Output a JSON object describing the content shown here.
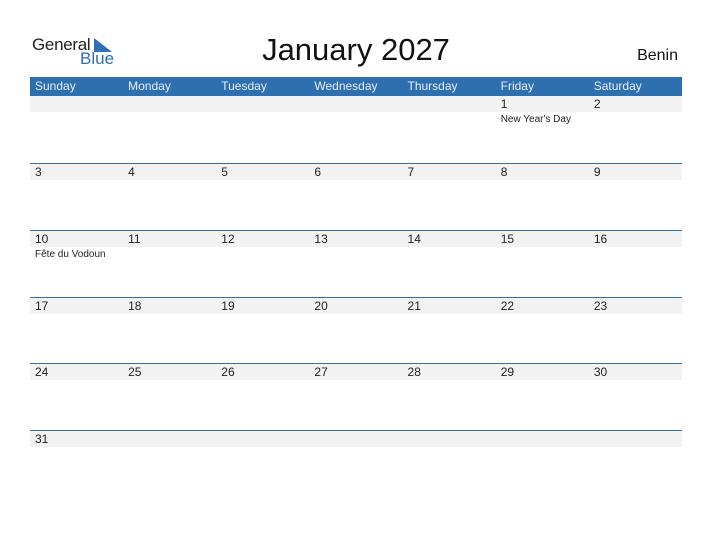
{
  "logo": {
    "part1": "General",
    "part2": "Blue"
  },
  "title": "January 2027",
  "country": "Benin",
  "days": [
    "Sunday",
    "Monday",
    "Tuesday",
    "Wednesday",
    "Thursday",
    "Friday",
    "Saturday"
  ],
  "weeks": [
    [
      {
        "d": ""
      },
      {
        "d": ""
      },
      {
        "d": ""
      },
      {
        "d": ""
      },
      {
        "d": ""
      },
      {
        "d": "1",
        "h": "New Year's Day"
      },
      {
        "d": "2"
      }
    ],
    [
      {
        "d": "3"
      },
      {
        "d": "4"
      },
      {
        "d": "5"
      },
      {
        "d": "6"
      },
      {
        "d": "7"
      },
      {
        "d": "8"
      },
      {
        "d": "9"
      }
    ],
    [
      {
        "d": "10",
        "h": "Fête du Vodoun"
      },
      {
        "d": "11"
      },
      {
        "d": "12"
      },
      {
        "d": "13"
      },
      {
        "d": "14"
      },
      {
        "d": "15"
      },
      {
        "d": "16"
      }
    ],
    [
      {
        "d": "17"
      },
      {
        "d": "18"
      },
      {
        "d": "19"
      },
      {
        "d": "20"
      },
      {
        "d": "21"
      },
      {
        "d": "22"
      },
      {
        "d": "23"
      }
    ],
    [
      {
        "d": "24"
      },
      {
        "d": "25"
      },
      {
        "d": "26"
      },
      {
        "d": "27"
      },
      {
        "d": "28"
      },
      {
        "d": "29"
      },
      {
        "d": "30"
      }
    ],
    [
      {
        "d": "31"
      },
      {
        "d": ""
      },
      {
        "d": ""
      },
      {
        "d": ""
      },
      {
        "d": ""
      },
      {
        "d": ""
      },
      {
        "d": ""
      }
    ]
  ]
}
